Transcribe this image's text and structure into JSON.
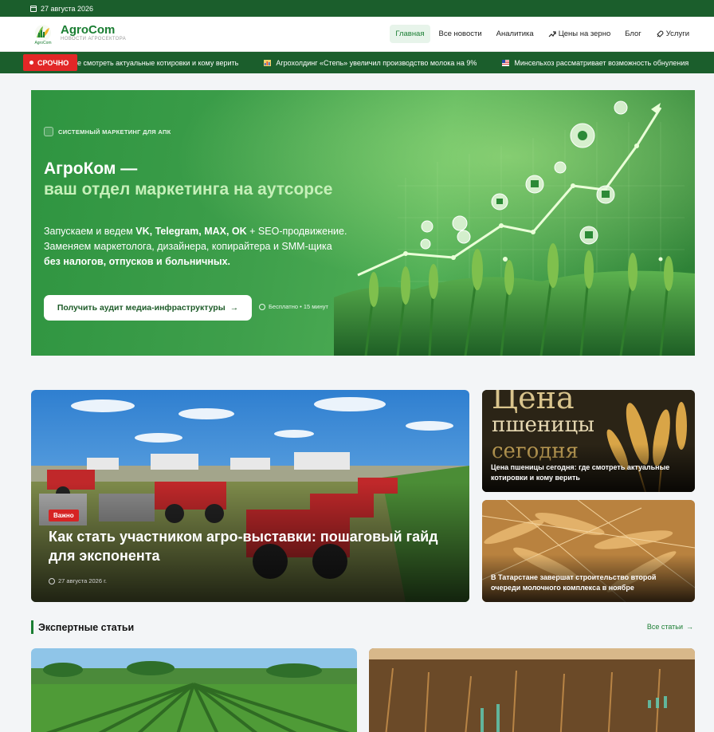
{
  "topbar": {
    "date": "27 августа 2026"
  },
  "brand": {
    "logo_text": "AgroCom",
    "title": "AgroCom",
    "subtitle": "НОВОСТИ АГРОСЕКТОРА"
  },
  "nav": {
    "items": [
      {
        "label": "Главная",
        "active": true
      },
      {
        "label": "Все новости"
      },
      {
        "label": "Аналитика"
      },
      {
        "label": "Цены на зерно",
        "icon": "trend-icon"
      },
      {
        "label": "Блог"
      },
      {
        "label": "Услуги",
        "icon": "rocket-icon"
      }
    ]
  },
  "ticker": {
    "badge": "СРОЧНО",
    "items": [
      {
        "text": "е смотреть актуальные котировки и кому верить"
      },
      {
        "text": "Агрохолдинг «Степь» увеличил производство молока на 9%",
        "icon": "chart-icon"
      },
      {
        "text": "Минсельхоз рассматривает возможность обнуления",
        "icon": "flag-icon"
      }
    ]
  },
  "hero": {
    "kicker": "СИСТЕМНЫЙ МАРКЕТИНГ ДЛЯ АПК",
    "title_line1": "АгроКом —",
    "title_line2": "ваш отдел маркетинга на аутсорсе",
    "p1_pre": "Запускаем и ведем ",
    "p1_bold": "VK, Telegram, MAX, OK",
    "p1_post": " + SEO-продвижение.",
    "p2": "Заменяем маркетолога, дизайнера, копирайтера и SMM-щика",
    "p3": "без налогов, отпусков и больничных.",
    "cta": "Получить аудит медиа-инфраструктуры",
    "note": "Бесплатно • 15 минут"
  },
  "feature": {
    "badge": "Важно",
    "title": "Как стать участником агро-выставки: пошаговый гайд для экспонента",
    "date": "27 августа 2026 г."
  },
  "side_cards": [
    {
      "image_text_1": "Цена",
      "image_text_2": "пшеницы",
      "image_text_3": "сегодня",
      "title": "Цена пшеницы сегодня: где смотреть актуальные котировки и кому верить"
    },
    {
      "title": "В Татарстане завершат строительство второй очереди молочного комплекса в ноябре"
    }
  ],
  "experts": {
    "heading": "Экспертные статьи",
    "all_link": "Все статьи"
  },
  "colors": {
    "brand_green": "#1b7e33",
    "dark_green": "#1b5e2c",
    "alert_red": "#e22727"
  }
}
